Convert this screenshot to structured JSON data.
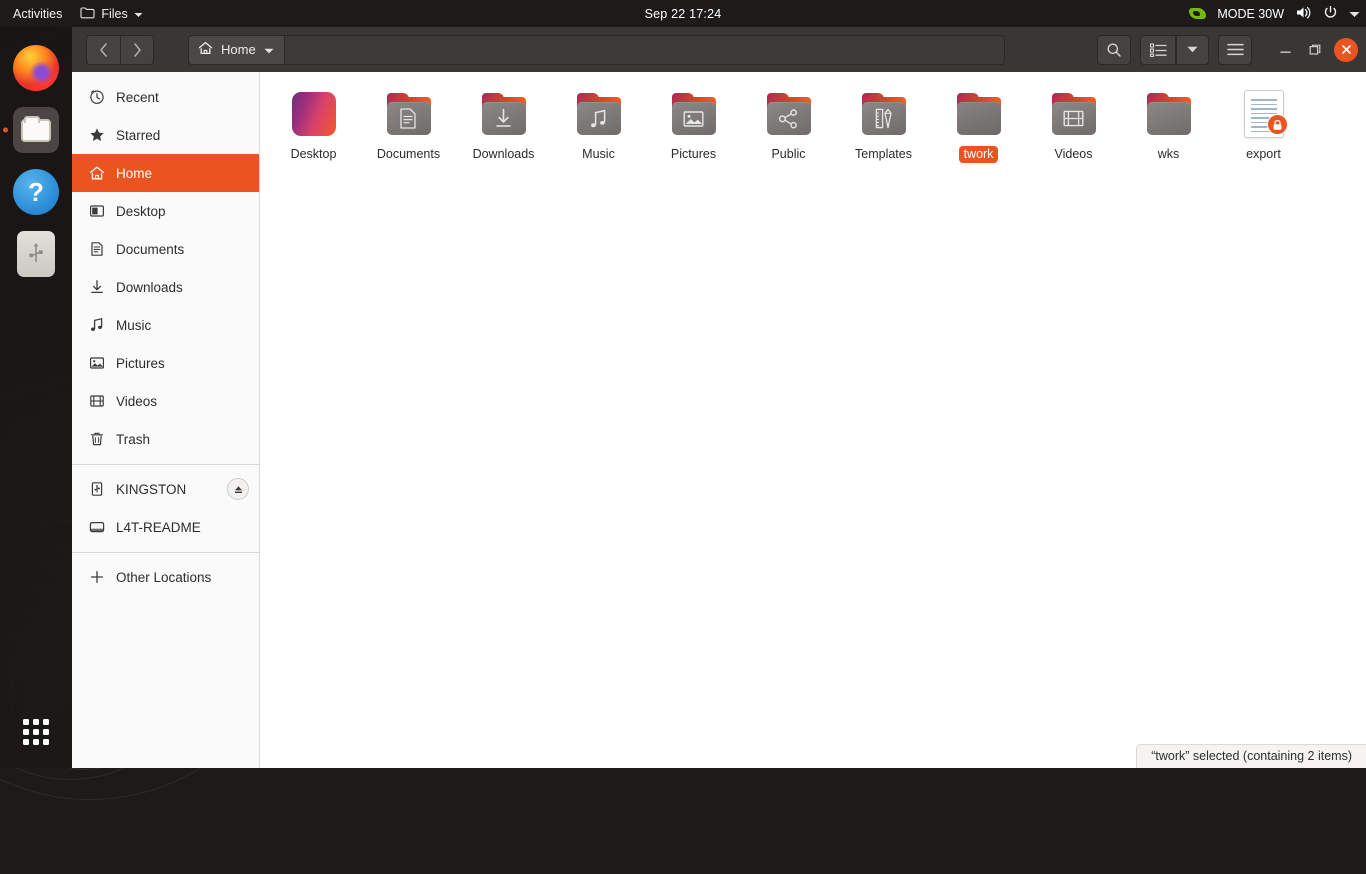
{
  "topbar": {
    "activities": "Activities",
    "app_menu": "Files",
    "app_menu_icon": "folder-icon",
    "clock": "Sep 22  17:24",
    "nvidia_icon": "nvidia-logo-icon",
    "power_mode": "MODE 30W",
    "volume_icon": "volume-icon",
    "power_icon": "power-icon",
    "menu_arrow_icon": "chevron-down-icon"
  },
  "dock": {
    "items": [
      {
        "name": "firefox",
        "icon": "firefox-icon",
        "running": false
      },
      {
        "name": "files",
        "icon": "files-icon",
        "running": true
      },
      {
        "name": "help",
        "icon": "help-icon",
        "glyph": "?",
        "running": false
      },
      {
        "name": "usb-drive",
        "icon": "usb-drive-icon",
        "running": false
      }
    ],
    "show_apps_label": "Show Applications"
  },
  "headerbar": {
    "back_icon": "chevron-left-icon",
    "forward_icon": "chevron-right-icon",
    "path_home_icon": "home-icon",
    "path_label": "Home",
    "path_dropdown_icon": "chevron-down-icon",
    "search_icon": "search-icon",
    "view_list_icon": "list-view-icon",
    "view_dropdown_icon": "chevron-down-icon",
    "menu_icon": "hamburger-menu-icon",
    "minimize_icon": "minimize-icon",
    "maximize_icon": "maximize-icon",
    "close_icon": "close-icon"
  },
  "sidebar": {
    "items": [
      {
        "label": "Recent",
        "icon": "clock-icon",
        "active": false
      },
      {
        "label": "Starred",
        "icon": "star-icon",
        "active": false
      },
      {
        "label": "Home",
        "icon": "home-icon",
        "active": true
      },
      {
        "label": "Desktop",
        "icon": "desktop-icon",
        "active": false
      },
      {
        "label": "Documents",
        "icon": "document-icon",
        "active": false
      },
      {
        "label": "Downloads",
        "icon": "download-icon",
        "active": false
      },
      {
        "label": "Music",
        "icon": "music-note-icon",
        "active": false
      },
      {
        "label": "Pictures",
        "icon": "image-icon",
        "active": false
      },
      {
        "label": "Videos",
        "icon": "film-icon",
        "active": false
      },
      {
        "label": "Trash",
        "icon": "trash-icon",
        "active": false
      }
    ],
    "devices": [
      {
        "label": "KINGSTON",
        "icon": "usb-icon",
        "eject": true,
        "eject_icon": "eject-icon"
      },
      {
        "label": "L4T-README",
        "icon": "disk-icon",
        "eject": false
      }
    ],
    "other_locations": {
      "label": "Other Locations",
      "icon": "plus-icon"
    }
  },
  "files": [
    {
      "name": "Desktop",
      "kind": "wallpaper",
      "emblem": "",
      "selected": false
    },
    {
      "name": "Documents",
      "kind": "folder",
      "emblem": "document-emblem",
      "selected": false
    },
    {
      "name": "Downloads",
      "kind": "folder",
      "emblem": "download-emblem",
      "selected": false
    },
    {
      "name": "Music",
      "kind": "folder",
      "emblem": "music-emblem",
      "selected": false
    },
    {
      "name": "Pictures",
      "kind": "folder",
      "emblem": "image-emblem",
      "selected": false
    },
    {
      "name": "Public",
      "kind": "folder",
      "emblem": "share-emblem",
      "selected": false
    },
    {
      "name": "Templates",
      "kind": "folder",
      "emblem": "templates-emblem",
      "selected": false
    },
    {
      "name": "twork",
      "kind": "folder",
      "emblem": "",
      "selected": true
    },
    {
      "name": "Videos",
      "kind": "folder",
      "emblem": "film-emblem",
      "selected": false
    },
    {
      "name": "wks",
      "kind": "folder",
      "emblem": "",
      "selected": false
    },
    {
      "name": "export",
      "kind": "document",
      "emblem": "lock-badge",
      "selected": false
    }
  ],
  "statusbar": {
    "text": "“twork” selected  (containing 2 items)"
  },
  "colors": {
    "accent": "#e95420",
    "headerbar": "#393634",
    "topbar": "#1d1a1a",
    "sidebar": "#fafafa",
    "nvidia_green": "#76b900"
  }
}
